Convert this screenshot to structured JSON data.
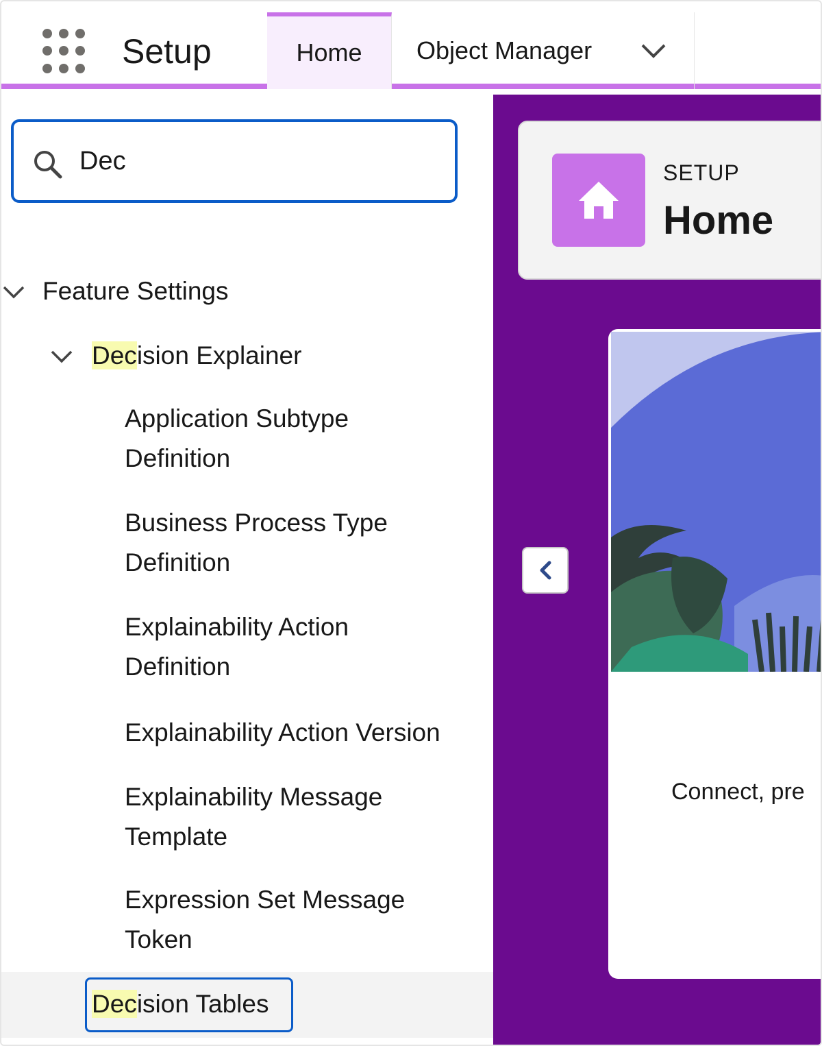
{
  "header": {
    "app_name": "Setup",
    "tabs": [
      {
        "label": "Home",
        "active": true
      },
      {
        "label": "Object Manager",
        "has_dropdown": true
      }
    ],
    "accent_color": "#c872e8"
  },
  "sidebar": {
    "search": {
      "value": "Dec",
      "placeholder": "Quick Find"
    },
    "tree": {
      "group_label": "Feature Settings",
      "subgroup": {
        "highlight": "Dec",
        "rest": "ision Explainer"
      },
      "items": [
        [
          "Application Subtype",
          "Definition"
        ],
        [
          "Business Process Type",
          "Definition"
        ],
        [
          "Explainability Action",
          "Definition"
        ],
        [
          "Explainability Action Version"
        ],
        [
          "Explainability Message",
          "Template"
        ],
        [
          "Expression Set Message",
          "Token"
        ]
      ],
      "selected": {
        "highlight": "Dec",
        "rest": "ision Tables"
      }
    }
  },
  "main": {
    "page_header": {
      "eyebrow": "SETUP",
      "title": "Home",
      "icon": "home-icon"
    },
    "hero": {
      "text": "Connect, pre"
    },
    "collapse_icon": "chevron-left-icon",
    "background_color": "#6b0b8f"
  }
}
